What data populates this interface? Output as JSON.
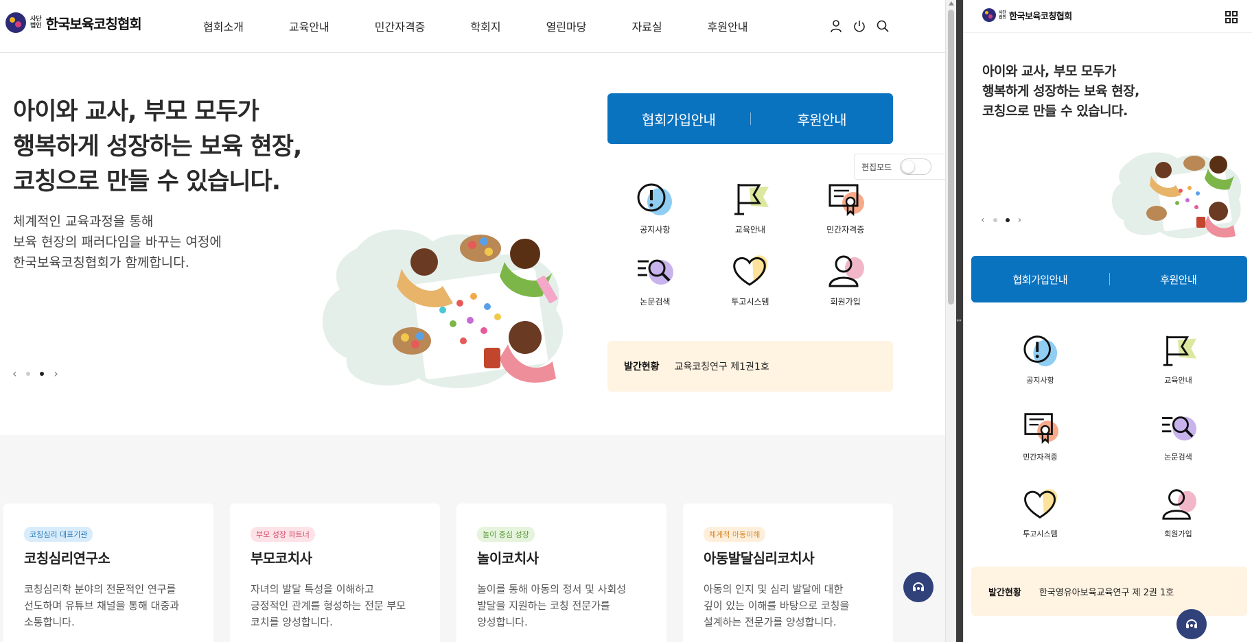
{
  "desktop": {
    "logo": {
      "sub": "사단\n법인",
      "sub1": "사단",
      "sub2": "법인",
      "name": "한국보육코칭협회"
    },
    "nav": [
      "협회소개",
      "교육안내",
      "민간자격증",
      "학회지",
      "열린마당",
      "자료실",
      "후원안내"
    ],
    "header_icons": [
      "user-icon",
      "power-icon",
      "search-icon"
    ],
    "hero": {
      "title": [
        "아이와 교사, 부모 모두가",
        "행복하게 성장하는 보육 현장,",
        "코칭으로 만들 수 있습니다."
      ],
      "desc": [
        "체계적인 교육과정을 통해",
        "보육 현장의 패러다임을 바꾸는 여정에",
        "한국보육코칭협회가 함께합니다."
      ],
      "slides": 2,
      "active_slide": 2
    },
    "cta": {
      "join": "협회가입안내",
      "support": "후원안내"
    },
    "edit_mode": {
      "label": "편집모드",
      "on": false
    },
    "quick_links": [
      {
        "label": "공지사항",
        "icon": "notice-icon"
      },
      {
        "label": "교육안내",
        "icon": "flag-icon"
      },
      {
        "label": "민간자격증",
        "icon": "certificate-icon"
      },
      {
        "label": "논문검색",
        "icon": "paper-search-icon"
      },
      {
        "label": "투고시스템",
        "icon": "heart-icon"
      },
      {
        "label": "회원가입",
        "icon": "person-icon"
      }
    ],
    "publication": {
      "label": "발간현황",
      "value": "교육코칭연구 제1권1호"
    },
    "cards": [
      {
        "badge": "코칭심리 대표기관",
        "badge_color": "#d8ecfb",
        "badge_text_color": "#2a7ab8",
        "title": "코칭심리연구소",
        "desc": [
          "코칭심리학 분야의 전문적인 연구를",
          "선도하며 유튜브 채널을 통해 대중과",
          "소통합니다."
        ]
      },
      {
        "badge": "부모 성장 파트너",
        "badge_color": "#fde3e7",
        "badge_text_color": "#d04a6a",
        "title": "부모코치사",
        "desc": [
          "자녀의 발달 특성을 이해하고",
          "긍정적인 관계를 형성하는 전문 부모",
          "코치를 양성합니다."
        ]
      },
      {
        "badge": "놀이 중심 성장",
        "badge_color": "#e6f4dd",
        "badge_text_color": "#5b9a3c",
        "title": "놀이코치사",
        "desc": [
          "놀이를 통해 아동의 정서 및 사회성",
          "발달을 지원하는 코칭 전문가를",
          "양성합니다."
        ]
      },
      {
        "badge": "체계적 아동이해",
        "badge_color": "#fdefdc",
        "badge_text_color": "#d98a2b",
        "title": "아동발달심리코치사",
        "desc": [
          "아동의 인지 및 심리 발달에 대한",
          "깊이 있는 이해를 바탕으로 코칭을",
          "설계하는 전문가를 양성합니다."
        ]
      }
    ]
  },
  "mobile": {
    "logo": {
      "sub1": "사단",
      "sub2": "법인",
      "name": "한국보육코칭협회"
    },
    "hero_title": [
      "아이와 교사, 부모 모두가",
      "행복하게 성장하는 보육 현장,",
      "코칭으로 만들 수 있습니다."
    ],
    "cta": {
      "join": "협회가입안내",
      "support": "후원안내"
    },
    "quick_links": [
      {
        "label": "공지사항",
        "icon": "notice-icon"
      },
      {
        "label": "교육안내",
        "icon": "flag-icon"
      },
      {
        "label": "민간자격증",
        "icon": "certificate-icon"
      },
      {
        "label": "논문검색",
        "icon": "paper-search-icon"
      },
      {
        "label": "투고시스템",
        "icon": "heart-icon"
      },
      {
        "label": "회원가입",
        "icon": "person-icon"
      }
    ],
    "publication": {
      "label": "발간현황",
      "value": "한국영유아보육교육연구 제 2권 1호"
    }
  },
  "colors": {
    "brand_blue": "#0a73c0",
    "pub_bg": "#fff3e2",
    "fab": "#31417a",
    "section_bg": "#f6f6f6"
  }
}
